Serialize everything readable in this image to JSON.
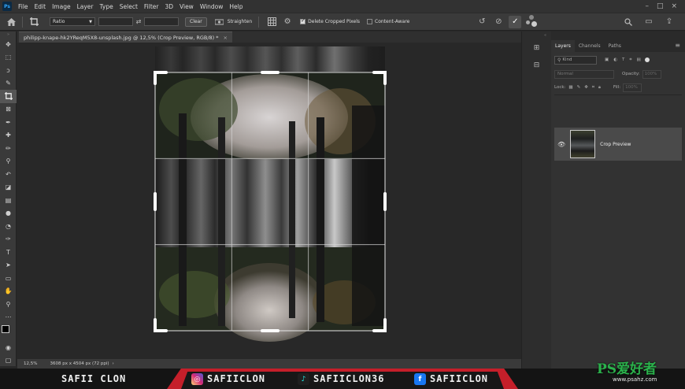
{
  "app": {
    "logo": "Ps"
  },
  "menu": [
    "File",
    "Edit",
    "Image",
    "Layer",
    "Type",
    "Select",
    "Filter",
    "3D",
    "View",
    "Window",
    "Help"
  ],
  "options": {
    "ratio_label": "Ratio",
    "clear_label": "Clear",
    "straighten_label": "Straighten",
    "delete_cropped_label": "Delete Cropped Pixels",
    "delete_cropped_checked": true,
    "content_aware_label": "Content-Aware",
    "content_aware_checked": false
  },
  "document": {
    "tab_title": "philipp-knape-hk2YReqM5X8-unsplash.jpg @ 12,5% (Crop Preview, RGB/8) *",
    "tab_close": "×"
  },
  "status": {
    "zoom": "12,5%",
    "info": "3608 px x 4504 px (72 ppi)"
  },
  "panel": {
    "tabs": [
      "Layers",
      "Channels",
      "Paths"
    ],
    "filter_placeholder": "Kind",
    "blend_mode": "Normal",
    "opacity_label": "Opacity:",
    "opacity_value": "100%",
    "lock_label": "Lock:",
    "fill_label": "Fill:",
    "fill_value": "100%",
    "layer_name": "Crop Preview"
  },
  "banner": {
    "name": "SAFII CLON",
    "instagram": "SAFIICLON",
    "tiktok": "SAFIICLON36",
    "facebook": "SAFIICLON",
    "watermark": "PS爱好者",
    "watermark_url": "www.psahz.com"
  },
  "colors": {
    "instagram": "#d62976",
    "tiktok": "#1f1f1f",
    "tiktok_glyph": "#25f4ee",
    "facebook": "#1877f2",
    "banner_red": "#c51f2a"
  }
}
